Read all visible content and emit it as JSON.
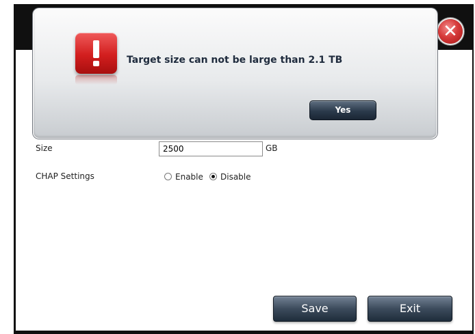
{
  "dialog": {
    "message": "Target size can not be large than 2.1 TB",
    "yes_label": "Yes",
    "icon": "alert-exclamation-icon"
  },
  "close_icon": "close-icon",
  "form": {
    "size_label": "Size",
    "size_value": "2500",
    "size_unit": "GB",
    "chap_label": "CHAP Settings",
    "chap_options": [
      {
        "label": "Enable",
        "selected": false
      },
      {
        "label": "Disable",
        "selected": true
      }
    ]
  },
  "buttons": {
    "save_label": "Save",
    "exit_label": "Exit"
  },
  "colors": {
    "dialog_button": "#2b3a4b",
    "alert_red": "#d21e1e",
    "window_frame": "#101010"
  }
}
